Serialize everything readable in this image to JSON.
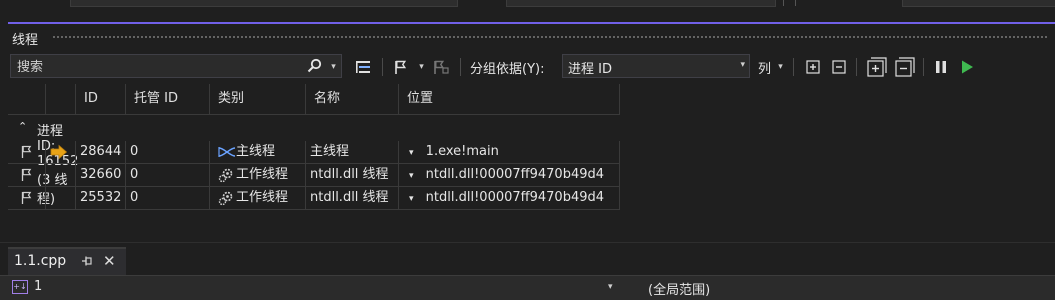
{
  "threads_window": {
    "title": "线程",
    "toolbar": {
      "search_placeholder": "搜索",
      "group_by_label": "分组依据(Y):",
      "group_by_value": "进程 ID",
      "columns_label": "列"
    },
    "columns": [
      "ID",
      "托管 ID",
      "类别",
      "名称",
      "位置"
    ],
    "group": {
      "label": "进程 ID: 16152  (3 线程)"
    },
    "rows": [
      {
        "id": "28644",
        "managed_id": "0",
        "category": "主线程",
        "name": "主线程",
        "location": "1.exe!main",
        "current": true,
        "category_icon": "main-thread-icon"
      },
      {
        "id": "32660",
        "managed_id": "0",
        "category": "工作线程",
        "name": "ntdll.dll 线程",
        "location": "ntdll.dll!00007ff9470b49d4",
        "current": false,
        "category_icon": "worker-thread-icon"
      },
      {
        "id": "25532",
        "managed_id": "0",
        "category": "工作线程",
        "name": "ntdll.dll 线程",
        "location": "ntdll.dll!00007ff9470b49d4",
        "current": false,
        "category_icon": "worker-thread-icon"
      }
    ]
  },
  "document_tab": {
    "label": "1.1.cpp"
  },
  "nav_bar": {
    "scope_left": "1",
    "scope_right": "(全局范围)"
  },
  "colors": {
    "accent": "#7160e8",
    "current_arrow": "#e8a317",
    "run_green": "#3fb950"
  }
}
